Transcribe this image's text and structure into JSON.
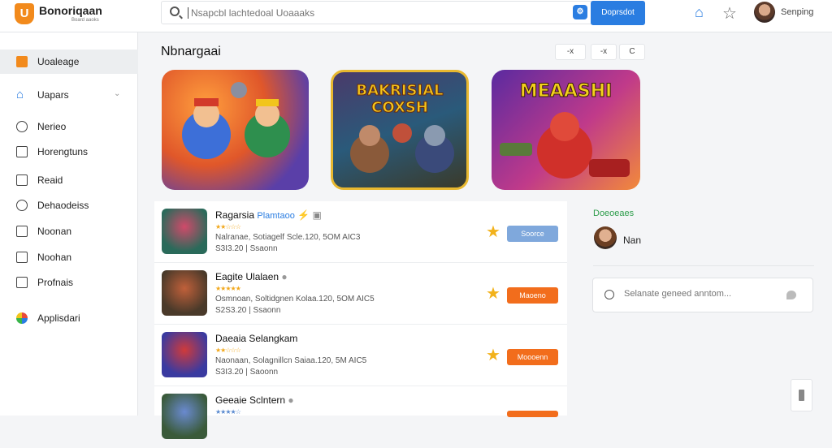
{
  "header": {
    "logo_letter": "U",
    "brand": "Bonoriqaan",
    "brand_sub": "Board aaoks",
    "search_placeholder": "Nsapcbl lachtedoal Uoaaaks",
    "search_button": "Doprsdot",
    "user_name": "Senping"
  },
  "sidebar": {
    "items": [
      {
        "label": "Uoaleage",
        "icon": "app-square-icon"
      },
      {
        "label": "Uapars",
        "icon": "home-icon"
      },
      {
        "label": "Nerieo",
        "icon": "circle-icon"
      },
      {
        "label": "Horengtuns",
        "icon": "grid-icon"
      },
      {
        "label": "Reaid",
        "icon": "box-icon"
      },
      {
        "label": "Dehaodeiss",
        "icon": "compass-icon"
      },
      {
        "label": "Noonan",
        "icon": "box-icon"
      },
      {
        "label": "Noohan",
        "icon": "list-icon"
      },
      {
        "label": "Profnais",
        "icon": "list-icon"
      },
      {
        "label": "Applisdari",
        "icon": "globe-icon"
      }
    ]
  },
  "main": {
    "title": "Nbnargaai",
    "controls": [
      "-x",
      "-x",
      "C"
    ]
  },
  "banners": [
    {
      "text": ""
    },
    {
      "text": "BAKRISIAL COXSH"
    },
    {
      "text": "MEAASHI"
    }
  ],
  "list": [
    {
      "title": "Ragarsia",
      "tag": "Plamtaoo",
      "meta": "Nalranae, Sotiagelf Scle.120,  5OM AIC3",
      "meta2": "S3I3.20 | Ssaonn",
      "button": "Soorce",
      "button_color": "#7fa8dc"
    },
    {
      "title": "Eagite Ulalaen",
      "tag": "",
      "meta": "Osmnoan, Soltidgnen Kolaa.120,  5OM AIC5",
      "meta2": "S2S3.20 | Ssaonn",
      "button": "Maoeno",
      "button_color": "#f26d1c"
    },
    {
      "title": "Daeaia Selangkam",
      "tag": "",
      "meta": "Naonaan, Solagnillcn Saiaa.120,  5M AIC5",
      "meta2": "S3I3.20 | Saoonn",
      "button": "Moooenn",
      "button_color": "#f26d1c"
    },
    {
      "title": "Geeaie Sclntern",
      "tag": "",
      "meta": "",
      "meta2": "",
      "button": "",
      "button_color": "#f26d1c"
    }
  ],
  "right_panel": {
    "title": "Doeoeaes",
    "user": "Nan",
    "comment_placeholder": "Selanate geneed anntom..."
  },
  "colors": {
    "accent": "#2a7de1",
    "orange": "#f26d1c",
    "green": "#2e9d4b"
  }
}
